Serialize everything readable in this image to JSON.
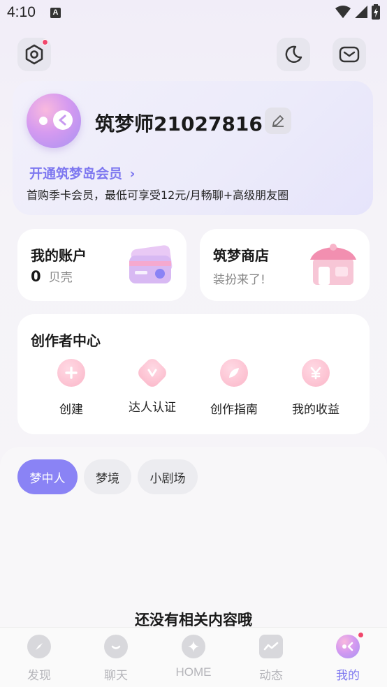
{
  "status_bar": {
    "time": "4:10",
    "notif_letter": "A"
  },
  "profile": {
    "username": "筑梦师21027816",
    "vip_link": "开通筑梦岛会员",
    "vip_desc": "首购季卡会员，最低可享受12元/月畅聊+高级朋友圈"
  },
  "account_card": {
    "title": "我的账户",
    "balance": "0",
    "unit": "贝壳"
  },
  "shop_card": {
    "title": "筑梦商店",
    "subtitle": "装扮来了!"
  },
  "creator": {
    "title": "创作者中心",
    "items": [
      {
        "label": "创建",
        "icon": "plus-icon"
      },
      {
        "label": "达人认证",
        "icon": "heart-badge-icon"
      },
      {
        "label": "创作指南",
        "icon": "feather-icon"
      },
      {
        "label": "我的收益",
        "icon": "yen-icon"
      }
    ]
  },
  "tabs": [
    {
      "label": "梦中人",
      "active": true
    },
    {
      "label": "梦境",
      "active": false
    },
    {
      "label": "小剧场",
      "active": false
    }
  ],
  "empty_text": "还没有相关内容哦",
  "nav": [
    {
      "label": "发现",
      "icon": "compass-icon",
      "active": false
    },
    {
      "label": "聊天",
      "icon": "chat-icon",
      "active": false
    },
    {
      "label": "HOME",
      "icon": "sparkle-icon",
      "active": false
    },
    {
      "label": "动态",
      "icon": "wave-icon",
      "active": false
    },
    {
      "label": "我的",
      "icon": "profile-avatar-icon",
      "active": true
    }
  ],
  "colors": {
    "accent": "#8a83f5",
    "vip": "#7e78f0",
    "badge": "#f0476b"
  }
}
